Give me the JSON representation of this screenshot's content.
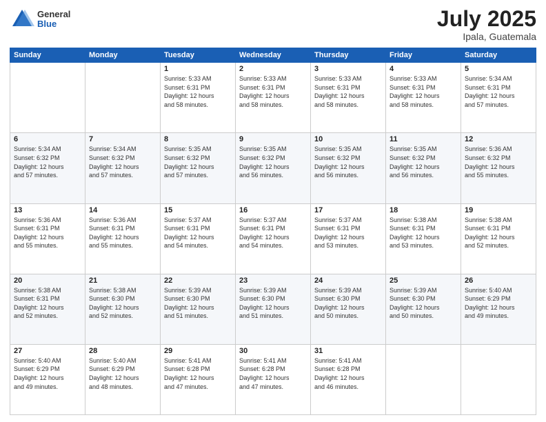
{
  "logo": {
    "general": "General",
    "blue": "Blue"
  },
  "title": {
    "month": "July 2025",
    "location": "Ipala, Guatemala"
  },
  "headers": [
    "Sunday",
    "Monday",
    "Tuesday",
    "Wednesday",
    "Thursday",
    "Friday",
    "Saturday"
  ],
  "weeks": [
    [
      {
        "day": "",
        "info": ""
      },
      {
        "day": "",
        "info": ""
      },
      {
        "day": "1",
        "info": "Sunrise: 5:33 AM\nSunset: 6:31 PM\nDaylight: 12 hours\nand 58 minutes."
      },
      {
        "day": "2",
        "info": "Sunrise: 5:33 AM\nSunset: 6:31 PM\nDaylight: 12 hours\nand 58 minutes."
      },
      {
        "day": "3",
        "info": "Sunrise: 5:33 AM\nSunset: 6:31 PM\nDaylight: 12 hours\nand 58 minutes."
      },
      {
        "day": "4",
        "info": "Sunrise: 5:33 AM\nSunset: 6:31 PM\nDaylight: 12 hours\nand 58 minutes."
      },
      {
        "day": "5",
        "info": "Sunrise: 5:34 AM\nSunset: 6:31 PM\nDaylight: 12 hours\nand 57 minutes."
      }
    ],
    [
      {
        "day": "6",
        "info": "Sunrise: 5:34 AM\nSunset: 6:32 PM\nDaylight: 12 hours\nand 57 minutes."
      },
      {
        "day": "7",
        "info": "Sunrise: 5:34 AM\nSunset: 6:32 PM\nDaylight: 12 hours\nand 57 minutes."
      },
      {
        "day": "8",
        "info": "Sunrise: 5:35 AM\nSunset: 6:32 PM\nDaylight: 12 hours\nand 57 minutes."
      },
      {
        "day": "9",
        "info": "Sunrise: 5:35 AM\nSunset: 6:32 PM\nDaylight: 12 hours\nand 56 minutes."
      },
      {
        "day": "10",
        "info": "Sunrise: 5:35 AM\nSunset: 6:32 PM\nDaylight: 12 hours\nand 56 minutes."
      },
      {
        "day": "11",
        "info": "Sunrise: 5:35 AM\nSunset: 6:32 PM\nDaylight: 12 hours\nand 56 minutes."
      },
      {
        "day": "12",
        "info": "Sunrise: 5:36 AM\nSunset: 6:32 PM\nDaylight: 12 hours\nand 55 minutes."
      }
    ],
    [
      {
        "day": "13",
        "info": "Sunrise: 5:36 AM\nSunset: 6:31 PM\nDaylight: 12 hours\nand 55 minutes."
      },
      {
        "day": "14",
        "info": "Sunrise: 5:36 AM\nSunset: 6:31 PM\nDaylight: 12 hours\nand 55 minutes."
      },
      {
        "day": "15",
        "info": "Sunrise: 5:37 AM\nSunset: 6:31 PM\nDaylight: 12 hours\nand 54 minutes."
      },
      {
        "day": "16",
        "info": "Sunrise: 5:37 AM\nSunset: 6:31 PM\nDaylight: 12 hours\nand 54 minutes."
      },
      {
        "day": "17",
        "info": "Sunrise: 5:37 AM\nSunset: 6:31 PM\nDaylight: 12 hours\nand 53 minutes."
      },
      {
        "day": "18",
        "info": "Sunrise: 5:38 AM\nSunset: 6:31 PM\nDaylight: 12 hours\nand 53 minutes."
      },
      {
        "day": "19",
        "info": "Sunrise: 5:38 AM\nSunset: 6:31 PM\nDaylight: 12 hours\nand 52 minutes."
      }
    ],
    [
      {
        "day": "20",
        "info": "Sunrise: 5:38 AM\nSunset: 6:31 PM\nDaylight: 12 hours\nand 52 minutes."
      },
      {
        "day": "21",
        "info": "Sunrise: 5:38 AM\nSunset: 6:30 PM\nDaylight: 12 hours\nand 52 minutes."
      },
      {
        "day": "22",
        "info": "Sunrise: 5:39 AM\nSunset: 6:30 PM\nDaylight: 12 hours\nand 51 minutes."
      },
      {
        "day": "23",
        "info": "Sunrise: 5:39 AM\nSunset: 6:30 PM\nDaylight: 12 hours\nand 51 minutes."
      },
      {
        "day": "24",
        "info": "Sunrise: 5:39 AM\nSunset: 6:30 PM\nDaylight: 12 hours\nand 50 minutes."
      },
      {
        "day": "25",
        "info": "Sunrise: 5:39 AM\nSunset: 6:30 PM\nDaylight: 12 hours\nand 50 minutes."
      },
      {
        "day": "26",
        "info": "Sunrise: 5:40 AM\nSunset: 6:29 PM\nDaylight: 12 hours\nand 49 minutes."
      }
    ],
    [
      {
        "day": "27",
        "info": "Sunrise: 5:40 AM\nSunset: 6:29 PM\nDaylight: 12 hours\nand 49 minutes."
      },
      {
        "day": "28",
        "info": "Sunrise: 5:40 AM\nSunset: 6:29 PM\nDaylight: 12 hours\nand 48 minutes."
      },
      {
        "day": "29",
        "info": "Sunrise: 5:41 AM\nSunset: 6:28 PM\nDaylight: 12 hours\nand 47 minutes."
      },
      {
        "day": "30",
        "info": "Sunrise: 5:41 AM\nSunset: 6:28 PM\nDaylight: 12 hours\nand 47 minutes."
      },
      {
        "day": "31",
        "info": "Sunrise: 5:41 AM\nSunset: 6:28 PM\nDaylight: 12 hours\nand 46 minutes."
      },
      {
        "day": "",
        "info": ""
      },
      {
        "day": "",
        "info": ""
      }
    ]
  ]
}
